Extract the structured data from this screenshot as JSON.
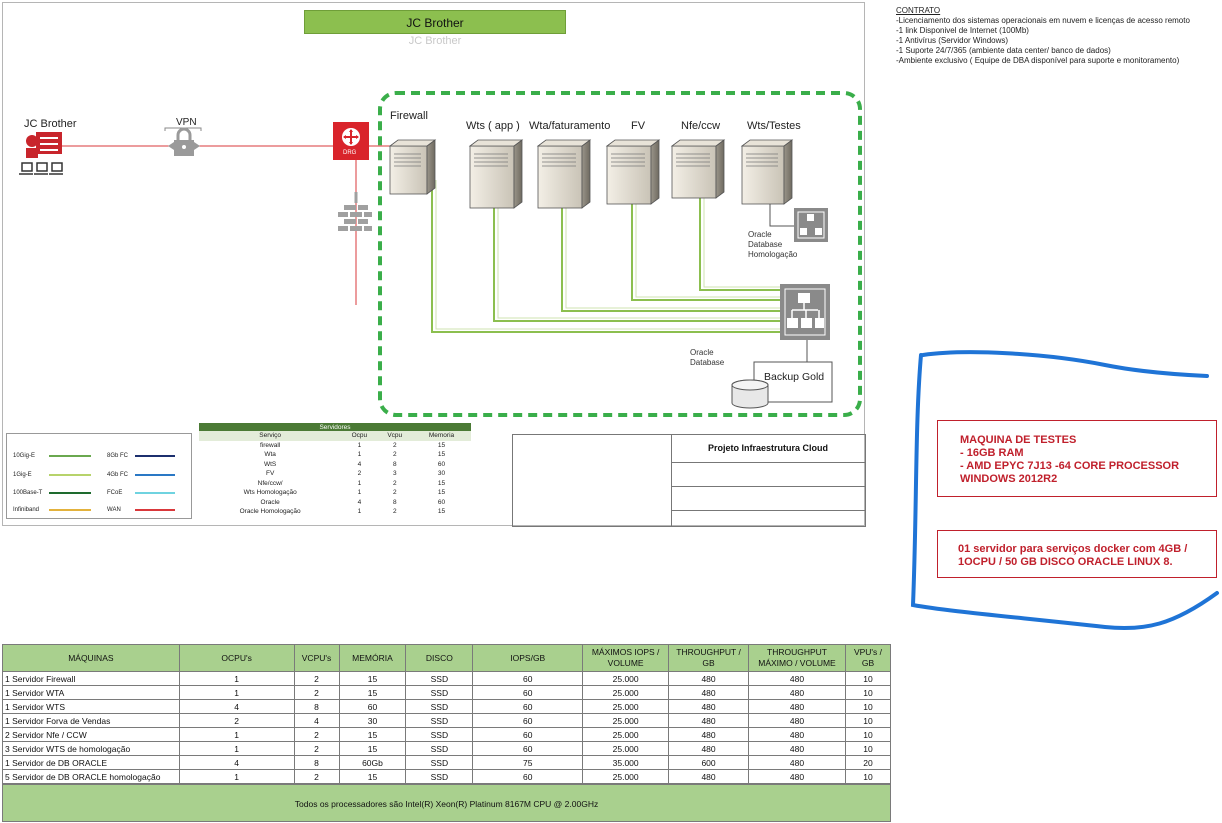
{
  "diagram": {
    "title": "JC Brother",
    "title_shadow": "JC Brother",
    "client_label": "JC Brother",
    "vpn_label": "VPN",
    "drg_label": "DRG",
    "firewall_label": "Firewall",
    "servers": [
      "Wts ( app )",
      "Wta/faturamento",
      "FV",
      "Nfe/ccw",
      "Wts/Testes"
    ],
    "oracle_homolog_label": "Oracle\nDatabase\nHomologação",
    "oracle_db_label": "Oracle\nDatabase",
    "backup_label": "Backup Gold",
    "colors": {
      "green_dash": "#3aae4a",
      "red_line": "#d9383b",
      "drg_red": "#d9242b",
      "green_line": "#8cbf4f",
      "blue_marker": "#1f74d6"
    }
  },
  "contract": {
    "heading": "CONTRATO",
    "items": [
      "-Licenciamento dos sistemas operacionais em nuvem e licenças de acesso remoto",
      "-1 link Disponivel de Internet (100Mb)",
      "-1 Antivírus (Servidor Windows)",
      "-1 Suporte 24/7/365 (ambiente data center/ banco de dados)",
      "-Ambiente exclusivo ( Equipe de DBA disponível para suporte e monitoramento)"
    ]
  },
  "legend": {
    "items": [
      {
        "label": "10Gig-E",
        "color": "#6aa84f"
      },
      {
        "label": "1Gig-E",
        "color": "#b7d36b"
      },
      {
        "label": "100Base-T",
        "color": "#1e6b2e"
      },
      {
        "label": "Infiniband",
        "color": "#e3b23c"
      },
      {
        "label": "8Gb FC",
        "color": "#1c2f6e"
      },
      {
        "label": "4Gb FC",
        "color": "#2a78c5"
      },
      {
        "label": "FCoE",
        "color": "#6fd3e0"
      },
      {
        "label": "WAN",
        "color": "#d9383b"
      }
    ]
  },
  "servidores_table": {
    "caption": "Servidores",
    "headers": [
      "Serviço",
      "Ocpu",
      "Vcpu",
      "Memoria"
    ],
    "rows": [
      [
        "firewall",
        "1",
        "2",
        "15"
      ],
      [
        "Wta",
        "1",
        "2",
        "15"
      ],
      [
        "WtS",
        "4",
        "8",
        "60"
      ],
      [
        "FV",
        "2",
        "3",
        "30"
      ],
      [
        "Nfe/ccw/",
        "1",
        "2",
        "15"
      ],
      [
        "Wts Homologação",
        "1",
        "2",
        "15"
      ],
      [
        "Oracle",
        "4",
        "8",
        "60"
      ],
      [
        "Oracle Homologação",
        "1",
        "2",
        "15"
      ]
    ]
  },
  "project": {
    "title": "Projeto Infraestrutura Cloud"
  },
  "test_machine": {
    "lines": [
      "MAQUINA DE TESTES",
      "- 16GB RAM",
      "- AMD EPYC 7J13 -64 CORE PROCESSOR",
      "WINDOWS 2012R2"
    ]
  },
  "docker_note": {
    "lines": [
      "01 servidor para serviços docker com 4GB /",
      "1OCPU / 50 GB DISCO ORACLE LINUX 8."
    ]
  },
  "machines_table": {
    "headers": [
      "MÁQUINAS",
      "OCPU's",
      "VCPU's",
      "MEMÓRIA",
      "DISCO",
      "IOPS/GB",
      "MÁXIMOS  IOPS / VOLUME",
      "THROUGHPUT / GB",
      "THROUGHPUT MÁXIMO / VOLUME",
      "VPU's / GB"
    ],
    "rows": [
      [
        "1 Servidor Firewall",
        "1",
        "2",
        "15",
        "SSD",
        "60",
        "25.000",
        "480",
        "480",
        "10"
      ],
      [
        "1 Servidor WTA",
        "1",
        "2",
        "15",
        "SSD",
        "60",
        "25.000",
        "480",
        "480",
        "10"
      ],
      [
        "1 Servidor WTS",
        "4",
        "8",
        "60",
        "SSD",
        "60",
        "25.000",
        "480",
        "480",
        "10"
      ],
      [
        "1 Servidor Forva de Vendas",
        "2",
        "4",
        "30",
        "SSD",
        "60",
        "25.000",
        "480",
        "480",
        "10"
      ],
      [
        "2 Servidor Nfe / CCW",
        "1",
        "2",
        "15",
        "SSD",
        "60",
        "25.000",
        "480",
        "480",
        "10"
      ],
      [
        "3 Servidor WTS de homologação",
        "1",
        "2",
        "15",
        "SSD",
        "60",
        "25.000",
        "480",
        "480",
        "10"
      ],
      [
        "1 Servidor de DB ORACLE",
        "4",
        "8",
        "60Gb",
        "SSD",
        "75",
        "35.000",
        "600",
        "480",
        "20"
      ],
      [
        "5 Servidor de DB ORACLE homologação",
        "1",
        "2",
        "15",
        "SSD",
        "60",
        "25.000",
        "480",
        "480",
        "10"
      ]
    ],
    "footer": "Todos os processadores são Intel(R) Xeon(R) Platinum 8167M CPU @ 2.00GHz"
  }
}
